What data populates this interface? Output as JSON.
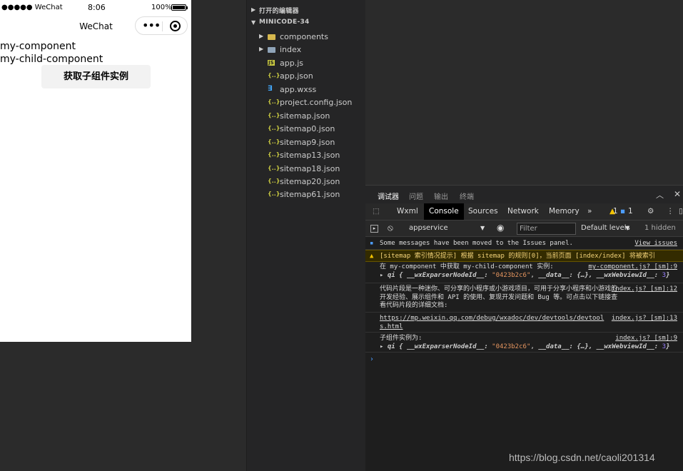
{
  "simulator": {
    "status": {
      "signal": "●●●●● WeChat",
      "time": "8:06",
      "battery": "100%"
    },
    "nav_title": "WeChat",
    "component_texts": [
      "my-component",
      "my-child-component"
    ],
    "button_label": "获取子组件实例"
  },
  "explorer": {
    "open_editors": "打开的编辑器",
    "project": "MINICODE-34",
    "items": [
      {
        "label": "components",
        "icon": "folder-icon",
        "type": "folder"
      },
      {
        "label": "index",
        "icon": "folder-icon",
        "type": "folder"
      },
      {
        "label": "app.js",
        "icon": "js-icon",
        "type": "file"
      },
      {
        "label": "app.json",
        "icon": "json-icon",
        "type": "file"
      },
      {
        "label": "app.wxss",
        "icon": "css-icon",
        "type": "file"
      },
      {
        "label": "project.config.json",
        "icon": "json-icon",
        "type": "file"
      },
      {
        "label": "sitemap.json",
        "icon": "json-icon",
        "type": "file"
      },
      {
        "label": "sitemap0.json",
        "icon": "json-icon",
        "type": "file"
      },
      {
        "label": "sitemap9.json",
        "icon": "json-icon",
        "type": "file"
      },
      {
        "label": "sitemap13.json",
        "icon": "json-icon",
        "type": "file"
      },
      {
        "label": "sitemap18.json",
        "icon": "json-icon",
        "type": "file"
      },
      {
        "label": "sitemap20.json",
        "icon": "json-icon",
        "type": "file"
      },
      {
        "label": "sitemap61.json",
        "icon": "json-icon",
        "type": "file"
      }
    ]
  },
  "devtools": {
    "top_tabs": [
      "调试器",
      "问题",
      "输出",
      "终端"
    ],
    "panel_tabs": [
      "Wxml",
      "Console",
      "Sources",
      "Network",
      "Memory"
    ],
    "warn_count": "1",
    "info_count": "1",
    "context": "appservice",
    "filter_placeholder": "Filter",
    "levels": "Default levels",
    "hidden": "1 hidden",
    "messages": {
      "issues_moved": "Some messages have been moved to the Issues panel.",
      "view_issues": "View issues",
      "sitemap_warn": "[sitemap 索引情况提示] 根据 sitemap 的规则[0]，当前页面 [index/index] 将被索引",
      "log1_text": "在 my-component 中获取 my-child-component 实例:",
      "log1_src": "my-component.js? [sm]:9",
      "obj_prefix": "qi {",
      "obj_key1": "__wxExparserNodeId__:",
      "obj_val1": "\"0423b2c6\"",
      "obj_key2": "__data__:",
      "obj_val2": "{…},",
      "obj_key3": "__wxWebviewId__:",
      "obj_val3": "3",
      "snippet_text": "代码片段是一种迷你、可分享的小程序或小游戏项目，可用于分享小程序和小游戏的开发经验、展示组件和 API 的使用、复现开发问题和 Bug 等。可点击以下链接查看代码片段的详细文档:",
      "snippet_src": "index.js? [sm]:12",
      "link": "https://mp.weixin.qq.com/debug/wxadoc/dev/devtools/devtools.html",
      "link_src": "index.js? [sm]:13",
      "log2_text": "子组件实例为:",
      "log2_src": "index.js? [sm]:9"
    }
  },
  "watermark": "https://blog.csdn.net/caoli201314"
}
